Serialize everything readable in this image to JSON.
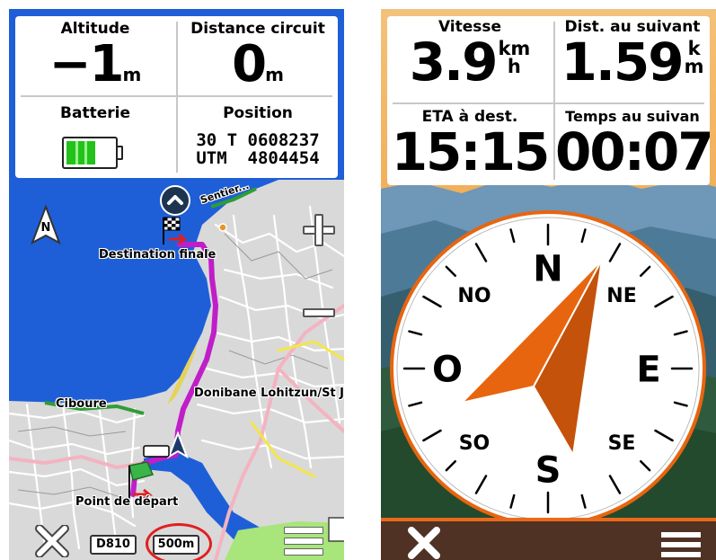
{
  "left_screen": {
    "fields": {
      "altitude": {
        "label": "Altitude",
        "value": "−1",
        "unit": "m"
      },
      "distance_circuit": {
        "label": "Distance circuit",
        "value": "0",
        "unit": "m"
      },
      "battery": {
        "label": "Batterie",
        "level_fraction": 0.6
      },
      "position": {
        "label": "Position",
        "line1": "30 T 0608237",
        "line2": "UTM  4804454"
      }
    },
    "map": {
      "labels": {
        "destination": "Destination finale",
        "ciboure": "Ciboure",
        "donibane": "Donibane Lohitzun/St J",
        "depart": "Point de départ",
        "sentier": "Sentier..."
      },
      "road_badge": "D810",
      "scale": "500m",
      "icons": [
        "north-arrow-icon",
        "zoom-in-icon",
        "zoom-out-icon",
        "expand-up-icon",
        "close-icon",
        "menu-icon",
        "checkered-flag-icon",
        "green-flag-icon",
        "position-arrow-icon"
      ],
      "colors": {
        "sea": "#1e5fd8",
        "land": "#d9d9d9",
        "route": "#c01ec8",
        "beach": "#e6d25a",
        "park": "#a8e57a"
      }
    }
  },
  "right_screen": {
    "fields": {
      "speed": {
        "label": "Vitesse",
        "value": "3.9",
        "unit_top": "km",
        "unit_bottom": "h"
      },
      "dist_next": {
        "label": "Dist. au suivant",
        "value": "1.59",
        "unit_top": "k",
        "unit_bottom": "m"
      },
      "eta": {
        "label": "ETA à dest.",
        "value": "15:15"
      },
      "time_next": {
        "label": "Temps au suivan",
        "value": "00:07"
      }
    },
    "compass": {
      "cardinals": {
        "N": "N",
        "NE": "NE",
        "E": "E",
        "SE": "SE",
        "S": "S",
        "SO": "SO",
        "O": "O",
        "NO": "NO"
      },
      "rotation_deg": 0,
      "colors": {
        "pointer": "#e8650f",
        "pointer_shade": "#c4520a",
        "ring": "#e8650f"
      }
    },
    "icons": [
      "close-icon",
      "menu-icon"
    ]
  }
}
